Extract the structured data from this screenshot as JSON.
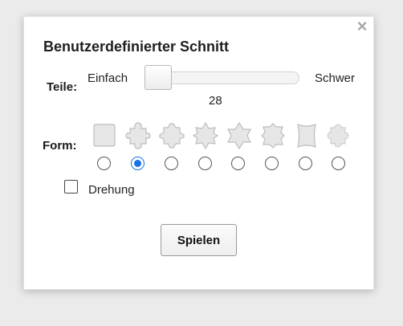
{
  "dialog": {
    "title": "Benutzerdefinierter Schnitt",
    "close_label": "×"
  },
  "pieces_row": {
    "label": "Teile:",
    "min_label": "Einfach",
    "max_label": "Schwer",
    "value": "28"
  },
  "shape_row": {
    "label": "Form:",
    "options": [
      {
        "icon": "square-piece-icon",
        "selected": false
      },
      {
        "icon": "jigsaw-piece-icon",
        "selected": true
      },
      {
        "icon": "jigsaw-piece-variant-icon",
        "selected": false
      },
      {
        "icon": "star-piece-icon",
        "selected": false
      },
      {
        "icon": "hexagram-piece-icon",
        "selected": false
      },
      {
        "icon": "notched-piece-icon",
        "selected": false
      },
      {
        "icon": "curved-piece-icon",
        "selected": false
      },
      {
        "icon": "round-tabbed-piece-icon",
        "selected": false
      }
    ]
  },
  "rotation": {
    "label": "Drehung",
    "checked": false
  },
  "play_button": {
    "label": "Spielen"
  },
  "colors": {
    "piece_fill": "#e6e6e6",
    "piece_stroke": "#bdbdbd",
    "radio_selected": "#1672e6"
  }
}
